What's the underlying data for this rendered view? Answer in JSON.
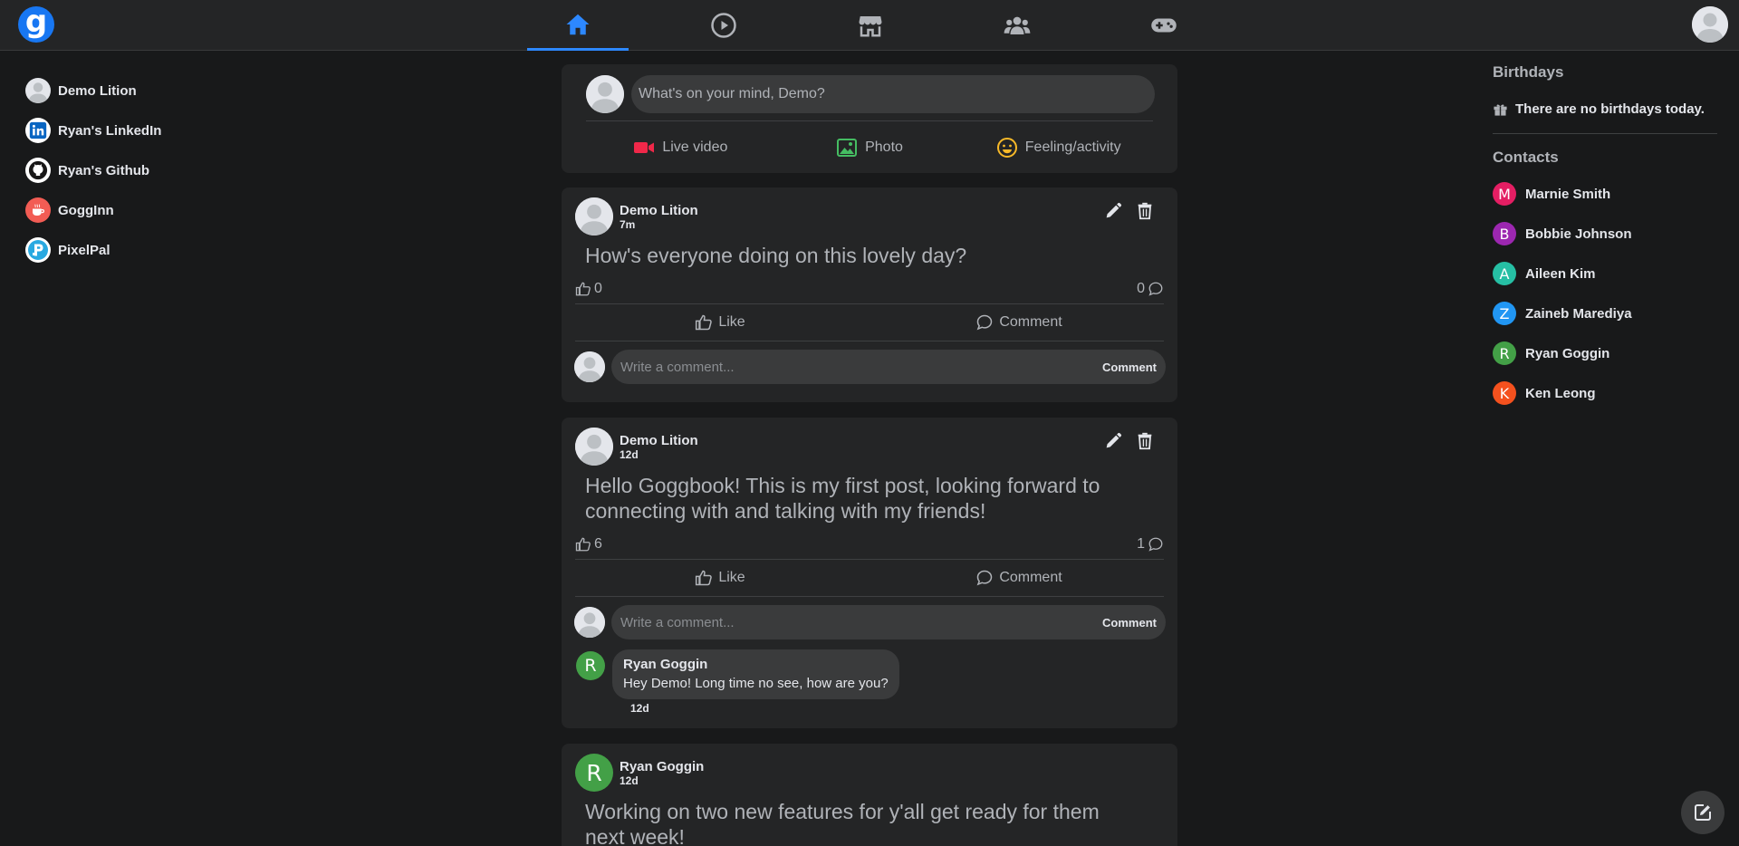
{
  "brand": {
    "logo_letter": "g",
    "color": "#1877f2"
  },
  "nav": {
    "tabs": [
      {
        "icon": "home-icon",
        "active": true
      },
      {
        "icon": "watch-icon",
        "active": false
      },
      {
        "icon": "marketplace-icon",
        "active": false
      },
      {
        "icon": "groups-icon",
        "active": false
      },
      {
        "icon": "gaming-icon",
        "active": false
      }
    ],
    "active_color": "#2d88ff"
  },
  "sidebar": {
    "items": [
      {
        "label": "Demo Lition",
        "icon": "avatar-icon"
      },
      {
        "label": "Ryan's LinkedIn",
        "icon": "linkedin-icon"
      },
      {
        "label": "Ryan's Github",
        "icon": "github-icon"
      },
      {
        "label": "GoggInn",
        "icon": "gogginn-icon"
      },
      {
        "label": "PixelPal",
        "icon": "pixelpal-icon"
      }
    ]
  },
  "composer": {
    "placeholder": "What's on your mind, Demo?",
    "actions": [
      {
        "label": "Live video",
        "icon": "live-video-icon",
        "color": "#f02849"
      },
      {
        "label": "Photo",
        "icon": "photo-icon",
        "color": "#45bd62"
      },
      {
        "label": "Feeling/activity",
        "icon": "feeling-icon",
        "color": "#f7b928"
      }
    ]
  },
  "posts": [
    {
      "author": "Demo Lition",
      "time": "7m",
      "body": "How's everyone doing on this lovely day?",
      "likes": "0",
      "comments": "0",
      "like_label": "Like",
      "comment_label": "Comment",
      "comment_placeholder": "Write a comment...",
      "comment_submit": "Comment"
    },
    {
      "author": "Demo Lition",
      "time": "12d",
      "body": "Hello Goggbook! This is my first post, looking forward to connecting with and talking with my friends!",
      "likes": "6",
      "comments": "1",
      "like_label": "Like",
      "comment_label": "Comment",
      "comment_placeholder": "Write a comment...",
      "comment_submit": "Comment",
      "comment": {
        "author": "Ryan Goggin",
        "author_initial": "R",
        "text": "Hey Demo! Long time no see, how are you?",
        "time": "12d"
      }
    },
    {
      "author": "Ryan Goggin",
      "author_initial": "R",
      "time": "12d",
      "body": "Working on two new features for y'all get ready for them next week!"
    }
  ],
  "right": {
    "birthdays_title": "Birthdays",
    "birthdays_text": "There are no birthdays today.",
    "contacts_title": "Contacts",
    "contacts": [
      {
        "name": "Marnie Smith",
        "initial": "M",
        "color": "#e41e63"
      },
      {
        "name": "Bobbie Johnson",
        "initial": "B",
        "color": "#9c27b0"
      },
      {
        "name": "Aileen Kim",
        "initial": "A",
        "color": "#26bfa4"
      },
      {
        "name": "Zaineb Marediya",
        "initial": "Z",
        "color": "#2196f3"
      },
      {
        "name": "Ryan Goggin",
        "initial": "R",
        "color": "#43a047"
      },
      {
        "name": "Ken Leong",
        "initial": "K",
        "color": "#f4511e"
      }
    ]
  }
}
